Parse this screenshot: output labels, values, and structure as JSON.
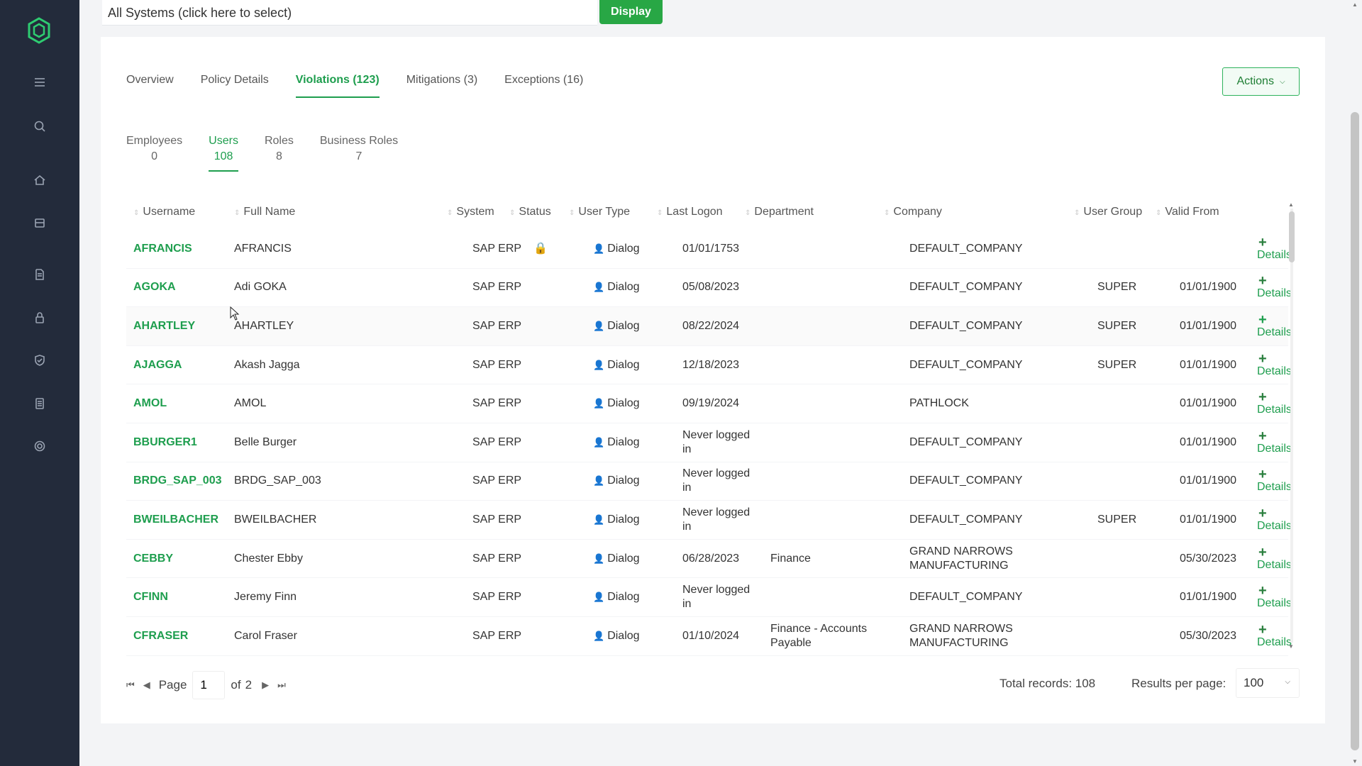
{
  "sidebar": {
    "icons": [
      "logo-icon",
      "menu-icon",
      "search-icon",
      "home-icon",
      "inbox-icon",
      "document-icon",
      "lock-icon",
      "shield-icon",
      "list-icon",
      "settings-icon"
    ]
  },
  "top": {
    "system_select": "All Systems (click here to select)",
    "display_label": "Display"
  },
  "tabs": [
    {
      "label": "Overview"
    },
    {
      "label": "Policy Details"
    },
    {
      "label": "Violations (123)",
      "active": true
    },
    {
      "label": "Mitigations (3)"
    },
    {
      "label": "Exceptions (16)"
    }
  ],
  "actions_label": "Actions",
  "subtabs": [
    {
      "label": "Employees",
      "count": "0"
    },
    {
      "label": "Users",
      "count": "108",
      "active": true
    },
    {
      "label": "Roles",
      "count": "8"
    },
    {
      "label": "Business Roles",
      "count": "7"
    }
  ],
  "columns": {
    "username": "Username",
    "full_name": "Full Name",
    "system": "System",
    "status": "Status",
    "user_type": "User Type",
    "last_logon": "Last Logon",
    "department": "Department",
    "company": "Company",
    "user_group": "User Group",
    "valid_from": "Valid From"
  },
  "details_label": "Details",
  "rows": [
    {
      "username": "AFRANCIS",
      "full_name": "AFRANCIS",
      "system": "SAP ERP",
      "locked": true,
      "user_type": "Dialog",
      "last_logon": "01/01/1753",
      "department": "",
      "company": "DEFAULT_COMPANY",
      "user_group": "",
      "valid_from": ""
    },
    {
      "username": "AGOKA",
      "full_name": "Adi GOKA",
      "system": "SAP ERP",
      "locked": false,
      "user_type": "Dialog",
      "last_logon": "05/08/2023",
      "department": "",
      "company": "DEFAULT_COMPANY",
      "user_group": "SUPER",
      "valid_from": "01/01/1900"
    },
    {
      "username": "AHARTLEY",
      "full_name": "AHARTLEY",
      "system": "SAP ERP",
      "locked": false,
      "user_type": "Dialog",
      "last_logon": "08/22/2024",
      "department": "",
      "company": "DEFAULT_COMPANY",
      "user_group": "SUPER",
      "valid_from": "01/01/1900"
    },
    {
      "username": "AJAGGA",
      "full_name": "Akash Jagga",
      "system": "SAP ERP",
      "locked": false,
      "user_type": "Dialog",
      "last_logon": "12/18/2023",
      "department": "",
      "company": "DEFAULT_COMPANY",
      "user_group": "SUPER",
      "valid_from": "01/01/1900"
    },
    {
      "username": "AMOL",
      "full_name": "AMOL",
      "system": "SAP ERP",
      "locked": false,
      "user_type": "Dialog",
      "last_logon": "09/19/2024",
      "department": "",
      "company": "PATHLOCK",
      "user_group": "",
      "valid_from": "01/01/1900"
    },
    {
      "username": "BBURGER1",
      "full_name": "Belle Burger",
      "system": "SAP ERP",
      "locked": false,
      "user_type": "Dialog",
      "last_logon": "Never logged in",
      "department": "",
      "company": "DEFAULT_COMPANY",
      "user_group": "",
      "valid_from": "01/01/1900"
    },
    {
      "username": "BRDG_SAP_003",
      "full_name": "BRDG_SAP_003",
      "system": "SAP ERP",
      "locked": false,
      "user_type": "Dialog",
      "last_logon": "Never logged in",
      "department": "",
      "company": "DEFAULT_COMPANY",
      "user_group": "",
      "valid_from": "01/01/1900"
    },
    {
      "username": "BWEILBACHER",
      "full_name": "BWEILBACHER",
      "system": "SAP ERP",
      "locked": false,
      "user_type": "Dialog",
      "last_logon": "Never logged in",
      "department": "",
      "company": "DEFAULT_COMPANY",
      "user_group": "SUPER",
      "valid_from": "01/01/1900"
    },
    {
      "username": "CEBBY",
      "full_name": "Chester Ebby",
      "system": "SAP ERP",
      "locked": false,
      "user_type": "Dialog",
      "last_logon": "06/28/2023",
      "department": "Finance",
      "company": "GRAND NARROWS MANUFACTURING",
      "user_group": "",
      "valid_from": "05/30/2023"
    },
    {
      "username": "CFINN",
      "full_name": "Jeremy Finn",
      "system": "SAP ERP",
      "locked": false,
      "user_type": "Dialog",
      "last_logon": "Never logged in",
      "department": "",
      "company": "DEFAULT_COMPANY",
      "user_group": "",
      "valid_from": "01/01/1900"
    },
    {
      "username": "CFRASER",
      "full_name": "Carol Fraser",
      "system": "SAP ERP",
      "locked": false,
      "user_type": "Dialog",
      "last_logon": "01/10/2024",
      "department": "Finance - Accounts Payable",
      "company": "GRAND NARROWS MANUFACTURING",
      "user_group": "",
      "valid_from": "05/30/2023"
    }
  ],
  "pager": {
    "page_label": "Page",
    "page_value": "1",
    "of_label": "of",
    "total_pages": "2",
    "total_records": "Total records: 108",
    "rpp_label": "Results per page:",
    "rpp_value": "100"
  },
  "colors": {
    "accent": "#1e9e4e",
    "sidebar": "#232b3b",
    "display_button": "#28a745"
  }
}
